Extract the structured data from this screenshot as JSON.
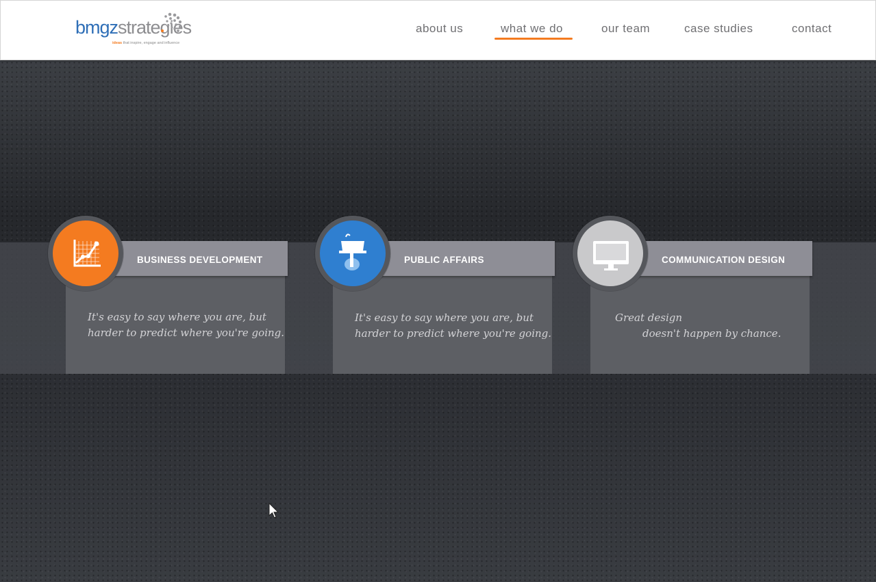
{
  "brand": {
    "logo_part1": "bmgz",
    "logo_part2": "strateg",
    "logo_part3": "ies",
    "tagline_ideas": "ideas",
    "tagline_rest": " that inspire, engage and influence"
  },
  "nav": {
    "items": [
      {
        "label": "about us"
      },
      {
        "label": "what we do"
      },
      {
        "label": "our team"
      },
      {
        "label": "case studies"
      },
      {
        "label": "contact"
      }
    ],
    "active": "what we do"
  },
  "services": [
    {
      "title": "BUSINESS DEVELOPMENT",
      "icon": "growth-chart-icon",
      "color": "#f47b20",
      "quote_line1": "It's easy to say where you are, but",
      "quote_line2": "harder to predict where you're going."
    },
    {
      "title": "PUBLIC AFFAIRS",
      "icon": "podium-icon",
      "color": "#2f7fd0",
      "quote_line1": "It's easy to say where you are, but",
      "quote_line2": "harder to predict where you're going."
    },
    {
      "title": "COMMUNICATION DESIGN",
      "icon": "monitor-icon",
      "color": "#c9c9cb",
      "quote_line1": "Great design",
      "quote_line2": "doesn't happen by chance."
    }
  ],
  "colors": {
    "accent": "#f47b20",
    "brand_blue": "#2f6fb7",
    "card_header": "#8e8e96",
    "card_body": "#5d5f64"
  }
}
